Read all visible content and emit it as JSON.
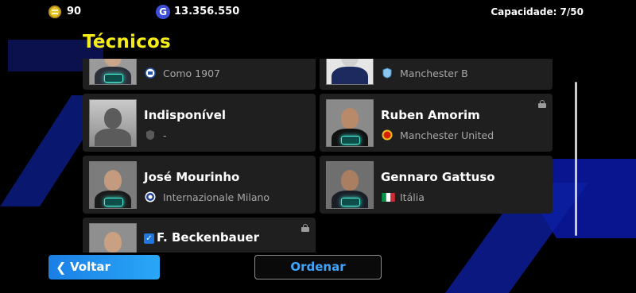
{
  "topbar": {
    "coins": "90",
    "gp": "13.356.550",
    "gp_icon_letter": "G",
    "capacity": "Capacidade: 7/50"
  },
  "section": {
    "title": "Técnicos"
  },
  "cards": [
    {
      "name": "",
      "club": "Como 1907",
      "club_icon": "como-1907-crest-icon",
      "photo": "coach-photo",
      "locked": false,
      "partial": true
    },
    {
      "name": "",
      "club": "Manchester B",
      "club_icon": "manchester-b-crest-icon",
      "photo": "generic-silhouette-suit",
      "locked": false,
      "partial": true
    },
    {
      "name": "Indisponível",
      "club": "-",
      "club_icon": "shield-icon",
      "photo": "unknown-silhouette",
      "locked": false
    },
    {
      "name": "Ruben Amorim",
      "club": "Manchester United",
      "club_icon": "manchester-united-crest-icon",
      "photo": "coach-photo",
      "locked": true
    },
    {
      "name": "José Mourinho",
      "club": "Internazionale Milano",
      "club_icon": "inter-crest-icon",
      "photo": "coach-photo",
      "locked": false
    },
    {
      "name": "Gennaro Gattuso",
      "club": "Itália",
      "club_icon": "italy-flag-icon",
      "photo": "coach-photo",
      "locked": false
    },
    {
      "name": "F. Beckenbauer",
      "club": "",
      "club_icon": "",
      "photo": "coach-photo",
      "locked": true,
      "checked": true
    }
  ],
  "buttons": {
    "back_label": "Voltar",
    "sort_label": "Ordenar"
  },
  "colors": {
    "title": "#f5ec1a",
    "accent_blue": "#1b7fe6",
    "card_bg": "#1f1f1f"
  }
}
